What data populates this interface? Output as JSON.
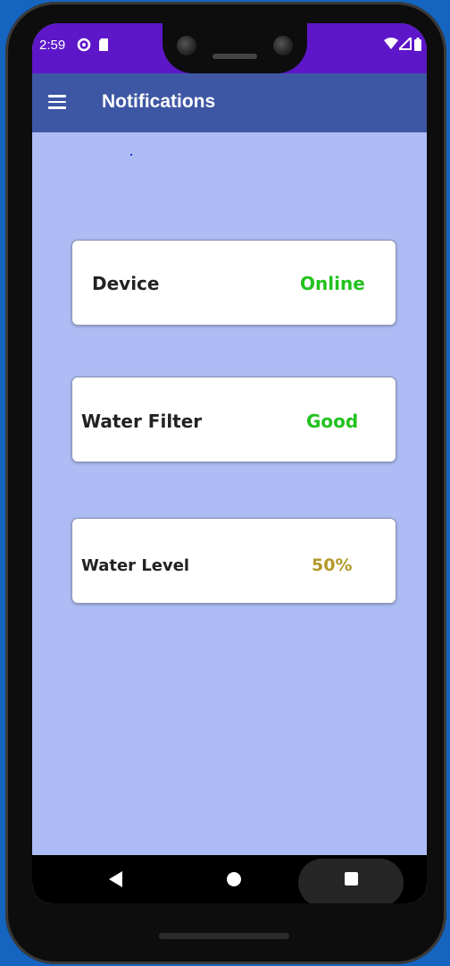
{
  "status_bar": {
    "time": "2:59",
    "left_icons": [
      "notification-ring-icon",
      "sd-card-icon"
    ],
    "right_icons": [
      "wifi-icon",
      "signal-icon",
      "battery-icon"
    ]
  },
  "app_bar": {
    "menu_icon": "hamburger-menu-icon",
    "title": "Notifications"
  },
  "cards": [
    {
      "label": "Device",
      "value": "Online",
      "value_color": "#22c21f"
    },
    {
      "label": "Water Filter",
      "value": "Good",
      "value_color": "#22c21f"
    },
    {
      "label": "Water Level",
      "value": "50%",
      "value_color": "#b49a2a"
    }
  ],
  "nav_bar": {
    "icons": [
      "back-icon",
      "home-icon",
      "recents-icon"
    ]
  },
  "colors": {
    "status_bar": "#5d17c8",
    "app_bar": "#3e57a4",
    "background": "#aebcf5",
    "outer": "#1565c0"
  }
}
